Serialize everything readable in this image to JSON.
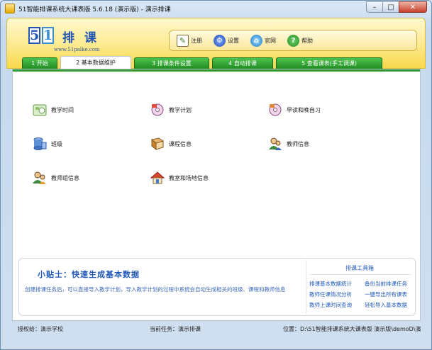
{
  "window": {
    "title": "51智能排课系统大课表版 5.6.18 (演示版) - 演示排课"
  },
  "header": {
    "logo": {
      "digit1": "5",
      "digit2": "1",
      "text": "排 课",
      "url": "www.51paike.com"
    },
    "toolbar": [
      {
        "label": "注册",
        "icon": "register-icon"
      },
      {
        "label": "设置",
        "icon": "settings-icon"
      },
      {
        "label": "官网",
        "icon": "website-icon"
      },
      {
        "label": "帮助",
        "icon": "help-icon"
      }
    ]
  },
  "tabs": [
    {
      "label": "1 开始",
      "active": false
    },
    {
      "label": "2 基本数据维护",
      "active": true
    },
    {
      "label": "3 排课条件设置",
      "active": false
    },
    {
      "label": "4 自动排课",
      "active": false
    },
    {
      "label": "5 查看课表(手工调课)",
      "active": false
    }
  ],
  "functions": [
    {
      "label": "教学时间",
      "icon": "calendar-icon"
    },
    {
      "label": "教学计划",
      "icon": "plan-disc-icon"
    },
    {
      "label": "早读和晚自习",
      "icon": "morning-evening-disc-icon"
    },
    {
      "label": "班级",
      "icon": "database-icon"
    },
    {
      "label": "课程信息",
      "icon": "book-icon"
    },
    {
      "label": "教师信息",
      "icon": "teacher-icon"
    },
    {
      "label": "教师组信息",
      "icon": "teacher-group-icon"
    },
    {
      "label": "教室和场地信息",
      "icon": "classroom-house-icon"
    }
  ],
  "tips": {
    "title": "小贴士：快速生成基本数据",
    "body": "创建排课任务后，可以直接导入教学计划，导入教学计划的过程中系统会自动生成相关的班级、课程和教师信息"
  },
  "toolbox": {
    "title": "排课工具箱",
    "items": [
      "排课基本数据统计",
      "备份当前排课任务",
      "教师任课情况分析",
      "一键导出所有课表",
      "教师上课时间查询",
      "轻松导入基本数据"
    ]
  },
  "status": {
    "school": "授权给：演示学校",
    "task": "当前任务：演示排课",
    "location": "位置：D:\\51智能排课系统大课表版 演示版\\demoD\\演"
  },
  "colors": {
    "tab_green": "#2f9a2f",
    "header_yellow": "#fde98e",
    "link_blue": "#2058b8"
  }
}
